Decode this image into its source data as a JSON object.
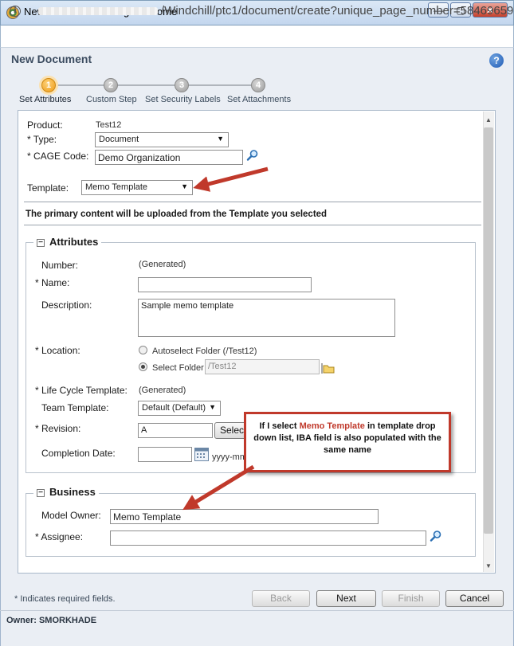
{
  "window": {
    "title": "New Document - Google Chrome",
    "minimize": "—",
    "maximize": "▢",
    "close": "✕"
  },
  "address": {
    "url": "/Windchill/ptc1/document/create?unique_page_number=58469659("
  },
  "dialog": {
    "title": "New Document",
    "help": "?"
  },
  "steps": [
    {
      "number": "1",
      "label": "Set Attributes",
      "active": true
    },
    {
      "number": "2",
      "label": "Custom Step",
      "active": false
    },
    {
      "number": "3",
      "label": "Set Security Labels",
      "active": false
    },
    {
      "number": "4",
      "label": "Set Attachments",
      "active": false
    }
  ],
  "header_fields": {
    "product_label": "Product:",
    "product_value": "Test12",
    "type_label": "* Type:",
    "type_value": "Document",
    "cage_label": "* CAGE Code:",
    "cage_value": "Demo Organization",
    "template_label": "Template:",
    "template_value": "Memo Template",
    "primary_content_note": "The primary content will be uploaded from the Template you selected"
  },
  "attributes": {
    "section_title": "Attributes",
    "collapse": "−",
    "number_label": "Number:",
    "number_value": "(Generated)",
    "name_label": "* Name:",
    "name_value": "",
    "description_label": "Description:",
    "description_value": "Sample memo template",
    "location_label": "* Location:",
    "autoselect_label": "Autoselect Folder (/Test12)",
    "select_folder_label": "Select Folder",
    "folder_value": "/Test12",
    "lifecycle_label": "* Life Cycle Template:",
    "lifecycle_value": "(Generated)",
    "team_label": "Team Template:",
    "team_value": "Default (Default)",
    "revision_label": "* Revision:",
    "revision_value": "A",
    "revision_button": "Selec",
    "completion_label": "Completion Date:",
    "completion_value": "",
    "date_hint": "yyyy-mm"
  },
  "business": {
    "section_title": "Business",
    "collapse": "−",
    "model_owner_label": "Model Owner:",
    "model_owner_value": "Memo Template",
    "assignee_label": "* Assignee:",
    "assignee_value": ""
  },
  "callout": {
    "before": "If I select ",
    "highlight": "Memo Template",
    "after": " in template drop down list, IBA field is also populated with the same name"
  },
  "footer": {
    "required_note": "* Indicates required fields.",
    "back": "Back",
    "next": "Next",
    "finish": "Finish",
    "cancel": "Cancel",
    "owner": "Owner: SMORKHADE"
  },
  "colors": {
    "annotation_red": "#c0392b",
    "active_step": "#ee9a15"
  }
}
